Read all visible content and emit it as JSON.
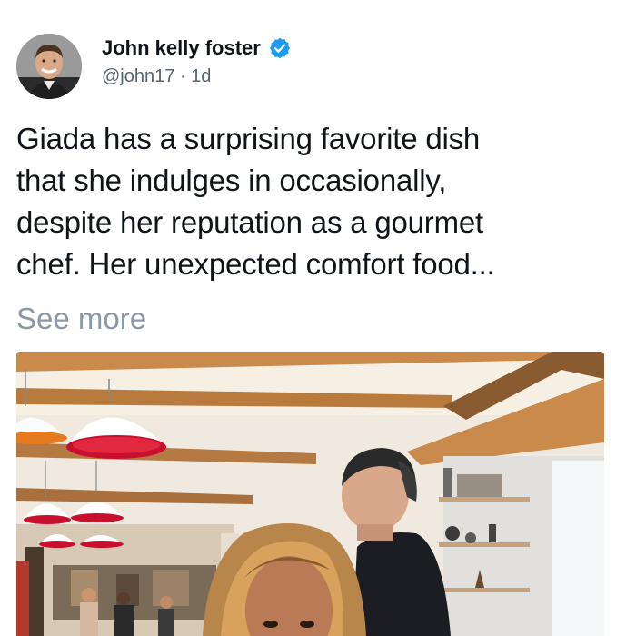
{
  "author": {
    "display_name": "John kelly foster",
    "handle": "@john17",
    "separator": "·",
    "time": "1d",
    "verified": true
  },
  "tweet": {
    "text_lines": [
      "Giada has a surprising favorite dish",
      "that she indulges in occasionally,",
      "despite her reputation as a gourmet",
      "chef. Her unexpected comfort food..."
    ],
    "see_more": "See more"
  },
  "media": {
    "type": "photo",
    "subject": "restaurant-interior"
  },
  "colors": {
    "text": "#0f1419",
    "secondary": "#536471",
    "see_more": "#8b98a5",
    "verified": "#1d9bf0",
    "lamp_red": "#c8102e"
  }
}
